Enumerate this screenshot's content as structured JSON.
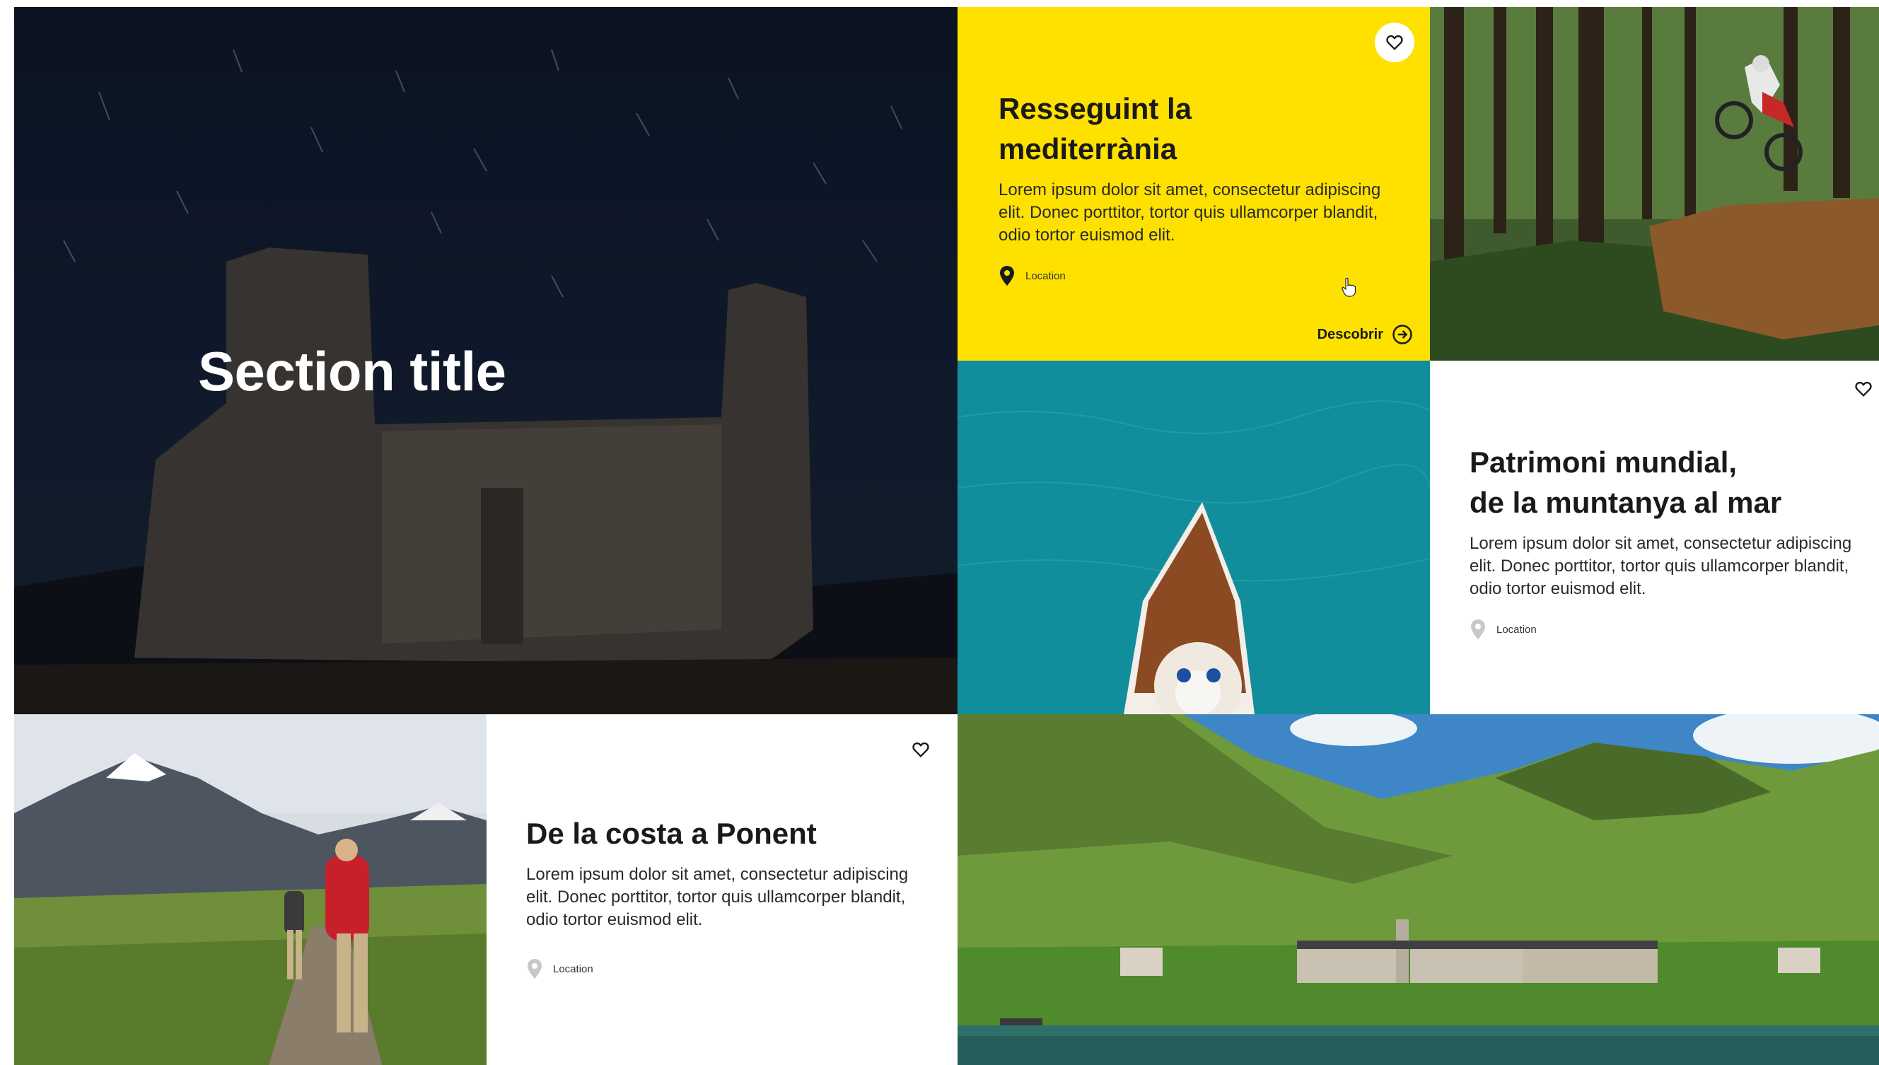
{
  "hero": {
    "title": "Section title"
  },
  "cards": [
    {
      "title_line1": "Resseguint la",
      "title_line2": "mediterrània",
      "body": "Lorem ipsum dolor sit amet, consectetur adipiscing elit. Donec porttitor, tortor quis ullamcorper blandit, odio tortor euismod elit.",
      "location": "Location",
      "cta": "Descobrir",
      "background": "#ffe100"
    },
    {
      "title_line1": "Patrimoni mundial,",
      "title_line2": "de la muntanya al mar",
      "body": "Lorem ipsum dolor sit amet, consectetur adipiscing elit. Donec porttitor, tortor quis ullamcorper blandit, odio tortor euismod elit.",
      "location": "Location",
      "background": "#ffffff"
    },
    {
      "title_line1": "De la costa a Ponent",
      "body": "Lorem ipsum dolor sit amet, consectetur adipiscing elit. Donec porttitor, tortor quis ullamcorper blandit, odio tortor euismod elit.",
      "location": "Location",
      "background": "#ffffff"
    }
  ],
  "icons": {
    "favorite": "heart-outline-icon",
    "location": "map-pin-icon",
    "cta": "arrow-circle-right-icon",
    "cursor": "hand-pointer-icon"
  }
}
